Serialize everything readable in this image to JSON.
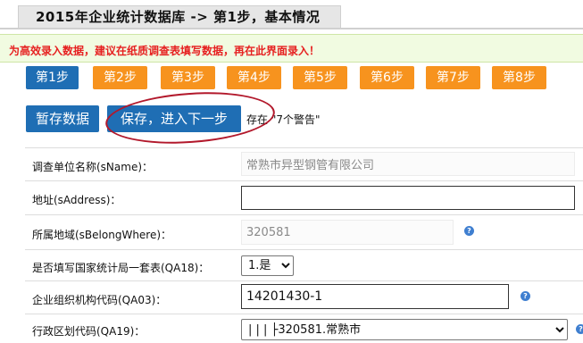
{
  "header": {
    "title": "2015年企业统计数据库 -> 第1步，基本情况"
  },
  "tip": "为高效录入数据，建议在纸质调查表填写数据，再在此界面录入！",
  "steps": [
    "第1步",
    "第2步",
    "第3步",
    "第4步",
    "第5步",
    "第6步",
    "第7步",
    "第8步"
  ],
  "actions": {
    "save_temp": "暂存数据",
    "save_next": "保存，进入下一步",
    "warnings": "存在 \"7个警告\""
  },
  "form": {
    "sname": {
      "label": "调查单位名称(sName)：",
      "value": "常熟市异型钢管有限公司"
    },
    "saddress": {
      "label": "地址(sAddress)：",
      "value": ""
    },
    "sbelong": {
      "label": "所属地域(sBelongWhere)：",
      "value": "320581"
    },
    "qa18": {
      "label": "是否填写国家统计局一套表(QA18)：",
      "value": "1.是"
    },
    "qa03": {
      "label": "企业组织机构代码(QA03)：",
      "value": "14201430-1"
    },
    "qa19": {
      "label": "行政区划代码(QA19)：",
      "value": "| | | ├320581.常熟市"
    }
  },
  "colors": {
    "step_active": "#1f6eb4",
    "step_inactive": "#f7931e",
    "tip_text": "#e62020",
    "tip_bg": "#f1fbe1",
    "annotation": "#b2182b"
  }
}
